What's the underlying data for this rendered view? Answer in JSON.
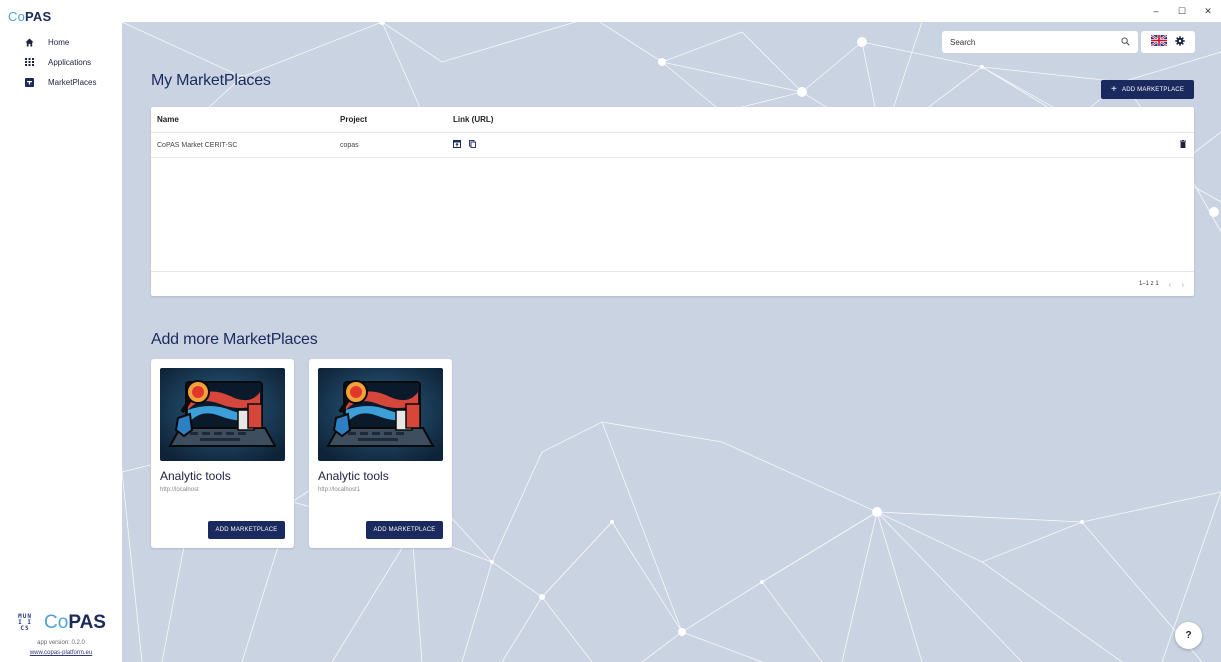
{
  "brand": {
    "prefix": "Co",
    "suffix": "PAS"
  },
  "nav": [
    {
      "label": "Home",
      "icon": "home-icon"
    },
    {
      "label": "Applications",
      "icon": "apps-grid-icon"
    },
    {
      "label": "MarketPlaces",
      "icon": "marketplace-icon"
    }
  ],
  "window": {
    "minimize": "–",
    "maximize": "☐",
    "close": "✕"
  },
  "search": {
    "placeholder": "Search"
  },
  "my_marketplaces": {
    "title": "My MarketPlaces",
    "add_button": "ADD MARKETPLACE",
    "columns": {
      "name": "Name",
      "project": "Project",
      "link": "Link (URL)"
    },
    "rows": [
      {
        "name": "CoPAS Market CERIT-SC",
        "project": "copas"
      }
    ],
    "pagination": "1–1 z 1"
  },
  "add_more": {
    "title": "Add more MarketPlaces",
    "cards": [
      {
        "title": "Analytic tools",
        "url": "http://localhost",
        "button": "ADD MARKETPLACE"
      },
      {
        "title": "Analytic tools",
        "url": "http://localhost1",
        "button": "ADD MARKETPLACE"
      }
    ]
  },
  "footer": {
    "muni": "MUNI ICS",
    "logo_prefix": "Co",
    "logo_suffix": "PAS",
    "version": "app version: 0.2.0",
    "website": "www.copas-platform.eu"
  },
  "help": "?",
  "colors": {
    "primary": "#1b2a5e",
    "background": "#c9d3e2",
    "accent": "#4ea3d8"
  }
}
